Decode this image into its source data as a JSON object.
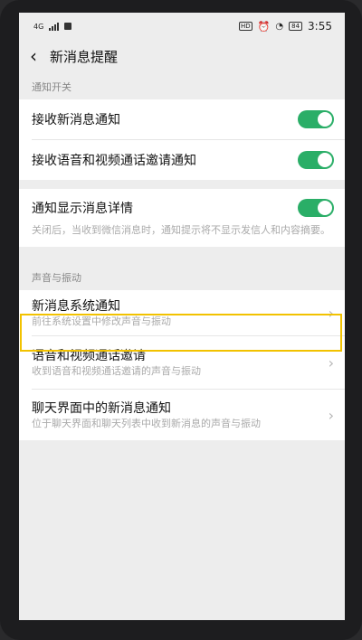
{
  "status_bar": {
    "carrier_text": "4G",
    "time": "3:55",
    "hd_label": "HD",
    "battery_text": "84"
  },
  "header": {
    "back_glyph": "‹",
    "title": "新消息提醒"
  },
  "section_notify": {
    "title": "通知开关",
    "items": [
      {
        "label": "接收新消息通知",
        "on": true
      },
      {
        "label": "接收语音和视频通话邀请通知",
        "on": true
      }
    ]
  },
  "detail": {
    "label": "通知显示消息详情",
    "on": true,
    "description": "关闭后，当收到微信消息时，通知提示将不显示发信人和内容摘要。"
  },
  "section_sound": {
    "title": "声音与振动",
    "items": [
      {
        "title": "新消息系统通知",
        "subtitle": "前往系统设置中修改声音与振动"
      },
      {
        "title": "语音和视频通话邀请",
        "subtitle": "收到语音和视频通话邀请的声音与振动"
      },
      {
        "title": "聊天界面中的新消息通知",
        "subtitle": "位于聊天界面和聊天列表中收到新消息的声音与振动"
      }
    ]
  },
  "colors": {
    "toggle_on": "#2aae67",
    "highlight": "#f2c200",
    "background": "#ededed"
  }
}
